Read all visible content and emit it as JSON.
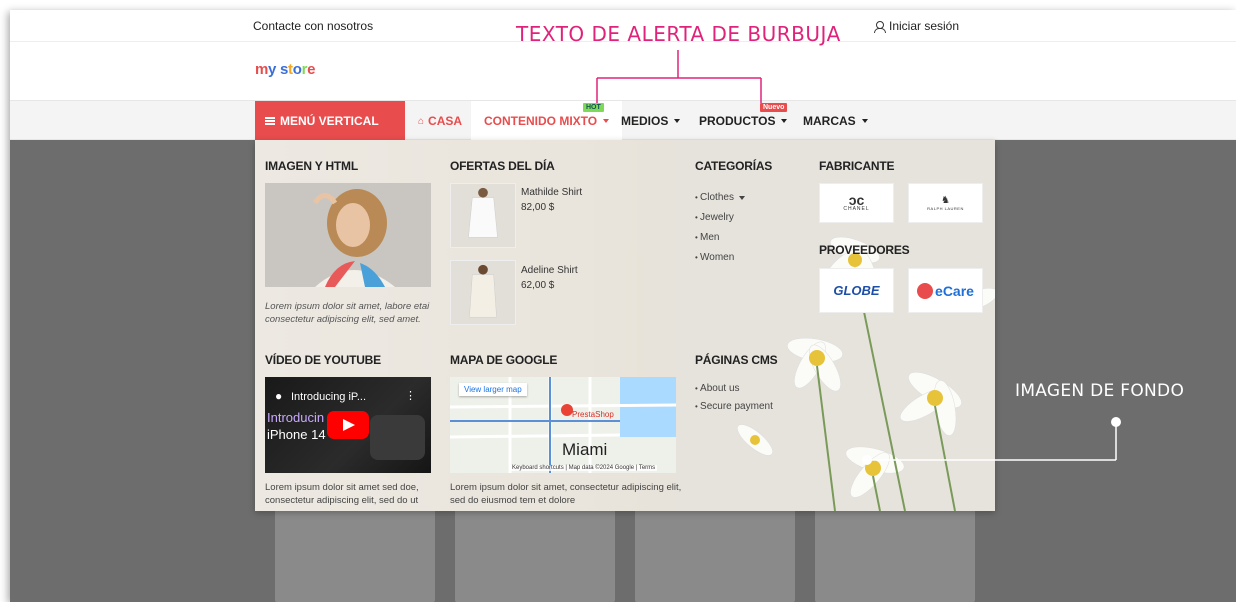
{
  "topbar": {
    "contact": "Contacte con nosotros",
    "login": "Iniciar sesión"
  },
  "logo": {
    "text_parts": [
      "m",
      "y",
      " ",
      "s",
      "t",
      "o",
      "r",
      "e"
    ],
    "colors": [
      "#e84c4c",
      "#3b6fd8",
      "",
      "#3b6fd8",
      "#f5a623",
      "#3b6fd8",
      "#7ed957",
      "#e84c4c"
    ]
  },
  "nav": {
    "vertical": "MENÚ VERTICAL",
    "casa": "CASA",
    "mixto": "CONTENIDO MIXTO",
    "medios": "MEDIOS",
    "productos": "PRODUCTOS",
    "marcas": "MARCAS",
    "badge_hot": "HOT",
    "badge_nuevo": "Nuevo"
  },
  "mega": {
    "image_html": {
      "title": "IMAGEN Y HTML",
      "text": "Lorem ipsum dolor sit amet, labore etai consectetur adipiscing elit, sed amet."
    },
    "offers": {
      "title": "OFERTAS DEL DÍA",
      "items": [
        {
          "name": "Mathilde Shirt",
          "price": "82,00 $"
        },
        {
          "name": "Adeline Shirt",
          "price": "62,00 $"
        }
      ]
    },
    "categories": {
      "title": "CATEGORÍAS",
      "items": [
        "Clothes",
        "Jewelry",
        "Men",
        "Women"
      ]
    },
    "manufacturers": {
      "title": "FABRICANTE",
      "items": [
        "CHANEL",
        "RALPH LAUREN"
      ]
    },
    "suppliers": {
      "title": "PROVEEDORES",
      "items": [
        "GLOBE",
        "eCare"
      ]
    },
    "youtube": {
      "title": "VÍDEO DE YOUTUBE",
      "video_title": "Introducing iP...",
      "overlay_line1": "Introducin",
      "overlay_line2": "iPhone 14",
      "text": "Lorem ipsum dolor sit amet sed doe, consectetur adipiscing elit, sed do ut"
    },
    "map": {
      "title": "MAPA DE GOOGLE",
      "button": "View larger map",
      "pin": "PrestaShop",
      "city": "Miami",
      "footer": "Keyboard shortcuts | Map data ©2024 Google | Terms",
      "text": "Lorem ipsum dolor sit amet, consectetur adipiscing elit, sed do eiusmod tem et dolore"
    },
    "cms": {
      "title": "PÁGINAS CMS",
      "items": [
        "About us",
        "Secure payment"
      ]
    }
  },
  "annotations": {
    "top": "TEXTO DE ALERTA DE BURBUJA",
    "right": "IMAGEN DE FONDO",
    "color": "#e0237a"
  }
}
